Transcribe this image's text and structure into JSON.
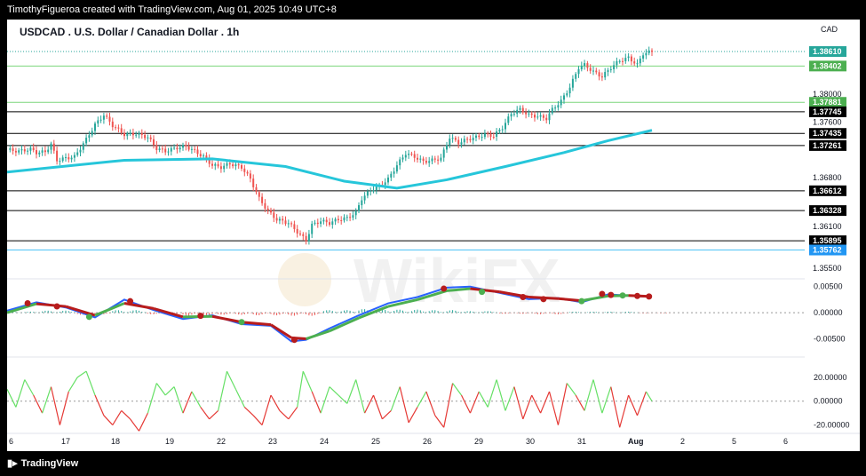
{
  "header": {
    "credit": "TimothyFigueroa created with TradingView.com, Aug 01, 2025 10:49 UTC+8"
  },
  "chart_title": "USDCAD . U.S. Dollar / Canadian Dollar . 1h",
  "currency": "CAD",
  "footer": {
    "brand": "TradingView",
    "logo_icon": "tradingview-logo-icon"
  },
  "watermark": "WikiFX",
  "colors": {
    "up": "#26a69a",
    "down": "#ef5350",
    "ma": "#26c6da",
    "macd_fast": "#2962ff",
    "macd_green": "#4caf50",
    "macd_red": "#b71c1c",
    "osc_green": "#66e066",
    "osc_red": "#e53935"
  },
  "chart_data": [
    {
      "type": "candlestick",
      "title": "USDCAD . U.S. Dollar / Canadian Dollar . 1h",
      "x_ticks": [
        "6",
        "17",
        "18",
        "19",
        "22",
        "23",
        "24",
        "25",
        "26",
        "29",
        "30",
        "31",
        "Aug",
        "2",
        "5",
        "6"
      ],
      "y_ticks": [
        "1.38000",
        "1.37600",
        "1.36800",
        "1.36100",
        "1.35500"
      ],
      "ylim": [
        1.3545,
        1.3898
      ],
      "close_path": [
        [
          0,
          1.372
        ],
        [
          4,
          1.3718
        ],
        [
          8,
          1.3721
        ],
        [
          10,
          1.3716
        ],
        [
          13,
          1.3717
        ],
        [
          15,
          1.3728
        ],
        [
          17,
          1.3705
        ],
        [
          20,
          1.3708
        ],
        [
          23,
          1.371
        ],
        [
          27,
          1.3735
        ],
        [
          30,
          1.3756
        ],
        [
          33,
          1.377
        ],
        [
          36,
          1.3755
        ],
        [
          40,
          1.3742
        ],
        [
          44,
          1.3743
        ],
        [
          48,
          1.3738
        ],
        [
          51,
          1.3722
        ],
        [
          54,
          1.3718
        ],
        [
          58,
          1.3723
        ],
        [
          61,
          1.3725
        ],
        [
          64,
          1.3718
        ],
        [
          67,
          1.371
        ],
        [
          70,
          1.3698
        ],
        [
          73,
          1.3695
        ],
        [
          76,
          1.37
        ],
        [
          80,
          1.3695
        ],
        [
          83,
          1.3678
        ],
        [
          86,
          1.365
        ],
        [
          89,
          1.3632
        ],
        [
          92,
          1.362
        ],
        [
          96,
          1.3615
        ],
        [
          100,
          1.3598
        ],
        [
          102,
          1.359
        ],
        [
          104,
          1.3612
        ],
        [
          107,
          1.3618
        ],
        [
          110,
          1.3615
        ],
        [
          113,
          1.362
        ],
        [
          116,
          1.3622
        ],
        [
          119,
          1.363
        ],
        [
          121,
          1.365
        ],
        [
          124,
          1.3662
        ],
        [
          127,
          1.3668
        ],
        [
          130,
          1.3678
        ],
        [
          133,
          1.3698
        ],
        [
          136,
          1.3715
        ],
        [
          139,
          1.371
        ],
        [
          142,
          1.3703
        ],
        [
          145,
          1.3705
        ],
        [
          148,
          1.3708
        ],
        [
          151,
          1.3738
        ],
        [
          154,
          1.373
        ],
        [
          157,
          1.3735
        ],
        [
          160,
          1.3738
        ],
        [
          163,
          1.3742
        ],
        [
          166,
          1.374
        ],
        [
          169,
          1.3752
        ],
        [
          172,
          1.3772
        ],
        [
          175,
          1.3778
        ],
        [
          178,
          1.377
        ],
        [
          181,
          1.3768
        ],
        [
          184,
          1.3765
        ],
        [
          186,
          1.3778
        ],
        [
          189,
          1.379
        ],
        [
          192,
          1.381
        ],
        [
          195,
          1.3838
        ],
        [
          197,
          1.3842
        ],
        [
          200,
          1.3832
        ],
        [
          203,
          1.3825
        ],
        [
          206,
          1.3838
        ],
        [
          209,
          1.3848
        ],
        [
          212,
          1.3852
        ],
        [
          215,
          1.3842
        ],
        [
          217,
          1.3858
        ],
        [
          220,
          1.3861
        ]
      ],
      "moving_average": [
        [
          0,
          1.3688
        ],
        [
          40,
          1.3705
        ],
        [
          70,
          1.3707
        ],
        [
          95,
          1.3696
        ],
        [
          115,
          1.3675
        ],
        [
          133,
          1.3665
        ],
        [
          150,
          1.3677
        ],
        [
          170,
          1.3696
        ],
        [
          190,
          1.3716
        ],
        [
          205,
          1.3733
        ],
        [
          220,
          1.3748
        ]
      ],
      "horizontal_levels": [
        {
          "value": 1.3861,
          "label": "1.38610",
          "kind": "current"
        },
        {
          "value": 1.38402,
          "label": "1.38402",
          "kind": "green"
        },
        {
          "value": 1.37881,
          "label": "1.37881",
          "kind": "green"
        },
        {
          "value": 1.37745,
          "label": "1.37745",
          "kind": "black"
        },
        {
          "value": 1.37435,
          "label": "1.37435",
          "kind": "black"
        },
        {
          "value": 1.37261,
          "label": "1.37261",
          "kind": "black"
        },
        {
          "value": 1.36612,
          "label": "1.36612",
          "kind": "black"
        },
        {
          "value": 1.36328,
          "label": "1.36328",
          "kind": "black"
        },
        {
          "value": 1.35895,
          "label": "1.35895",
          "kind": "black"
        },
        {
          "value": 1.35762,
          "label": "1.35762",
          "kind": "blue"
        }
      ]
    },
    {
      "type": "line",
      "y_ticks": [
        "0.00500",
        "0.00000",
        "-0.00500"
      ],
      "ylim": [
        -0.0078,
        0.0058
      ],
      "macd": [
        [
          0,
          0.0004
        ],
        [
          10,
          0.002
        ],
        [
          20,
          0.001
        ],
        [
          30,
          -0.0009
        ],
        [
          40,
          0.0025
        ],
        [
          50,
          0.0005
        ],
        [
          60,
          -0.0012
        ],
        [
          70,
          -0.0005
        ],
        [
          80,
          -0.0022
        ],
        [
          90,
          -0.0025
        ],
        [
          97,
          -0.0055
        ],
        [
          102,
          -0.0052
        ],
        [
          110,
          -0.003
        ],
        [
          120,
          -0.0005
        ],
        [
          130,
          0.0018
        ],
        [
          140,
          0.003
        ],
        [
          150,
          0.0048
        ],
        [
          158,
          0.005
        ],
        [
          168,
          0.0038
        ],
        [
          178,
          0.0026
        ],
        [
          188,
          0.0028
        ],
        [
          196,
          0.002
        ],
        [
          205,
          0.0035
        ],
        [
          212,
          0.0033
        ],
        [
          220,
          0.003
        ]
      ],
      "signal": [
        [
          0,
          0.0
        ],
        [
          10,
          0.0017
        ],
        [
          20,
          0.0012
        ],
        [
          30,
          -0.0005
        ],
        [
          40,
          0.0018
        ],
        [
          50,
          0.0008
        ],
        [
          60,
          -0.0008
        ],
        [
          70,
          -0.0007
        ],
        [
          80,
          -0.0018
        ],
        [
          90,
          -0.0023
        ],
        [
          97,
          -0.0048
        ],
        [
          102,
          -0.005
        ],
        [
          110,
          -0.0035
        ],
        [
          120,
          -0.001
        ],
        [
          130,
          0.0012
        ],
        [
          140,
          0.0025
        ],
        [
          150,
          0.0042
        ],
        [
          158,
          0.0046
        ],
        [
          168,
          0.004
        ],
        [
          178,
          0.003
        ],
        [
          188,
          0.0027
        ],
        [
          196,
          0.0023
        ],
        [
          205,
          0.0032
        ],
        [
          212,
          0.0033
        ],
        [
          220,
          0.0031
        ]
      ],
      "cross_points": [
        [
          7,
          0.0018
        ],
        [
          17,
          0.0012
        ],
        [
          28,
          -0.0008
        ],
        [
          42,
          0.0022
        ],
        [
          66,
          -0.0006
        ],
        [
          80,
          -0.0018
        ],
        [
          98,
          -0.0052
        ],
        [
          149,
          0.0046
        ],
        [
          162,
          0.004
        ],
        [
          176,
          0.003
        ],
        [
          183,
          0.0026
        ],
        [
          196,
          0.0022
        ],
        [
          203,
          0.0036
        ],
        [
          206,
          0.0034
        ],
        [
          210,
          0.0033
        ],
        [
          215,
          0.0032
        ],
        [
          219,
          0.0031
        ]
      ],
      "histogram": [
        [
          0,
          0.0002
        ],
        [
          12,
          0.0004
        ],
        [
          24,
          -0.0004
        ],
        [
          36,
          0.0005
        ],
        [
          48,
          -0.0003
        ],
        [
          60,
          -0.0006
        ],
        [
          72,
          -0.0004
        ],
        [
          84,
          -0.0005
        ],
        [
          96,
          -0.0006
        ],
        [
          108,
          0.0005
        ],
        [
          120,
          0.0007
        ],
        [
          132,
          0.0006
        ],
        [
          144,
          0.0005
        ],
        [
          156,
          0.0003
        ],
        [
          168,
          -0.0002
        ],
        [
          180,
          -0.0003
        ],
        [
          192,
          0.0002
        ],
        [
          204,
          0.0002
        ],
        [
          216,
          -0.0001
        ]
      ]
    },
    {
      "type": "line",
      "y_ticks": [
        "20.00000",
        "0.00000",
        "-20.00000"
      ],
      "ylim": [
        -27,
        34
      ],
      "values": [
        [
          0,
          10
        ],
        [
          3,
          -5
        ],
        [
          6,
          18
        ],
        [
          9,
          5
        ],
        [
          12,
          -10
        ],
        [
          15,
          12
        ],
        [
          18,
          -20
        ],
        [
          21,
          8
        ],
        [
          24,
          20
        ],
        [
          27,
          25
        ],
        [
          30,
          5
        ],
        [
          33,
          -12
        ],
        [
          36,
          -20
        ],
        [
          39,
          -8
        ],
        [
          42,
          -15
        ],
        [
          45,
          -25
        ],
        [
          48,
          -10
        ],
        [
          51,
          15
        ],
        [
          54,
          5
        ],
        [
          57,
          12
        ],
        [
          60,
          -10
        ],
        [
          63,
          8
        ],
        [
          66,
          -5
        ],
        [
          69,
          -15
        ],
        [
          72,
          -8
        ],
        [
          75,
          25
        ],
        [
          78,
          10
        ],
        [
          81,
          -5
        ],
        [
          84,
          -12
        ],
        [
          87,
          -20
        ],
        [
          90,
          5
        ],
        [
          93,
          -8
        ],
        [
          96,
          -15
        ],
        [
          99,
          -5
        ],
        [
          101,
          25
        ],
        [
          104,
          8
        ],
        [
          107,
          -10
        ],
        [
          110,
          12
        ],
        [
          113,
          5
        ],
        [
          116,
          -2
        ],
        [
          119,
          18
        ],
        [
          122,
          -10
        ],
        [
          125,
          5
        ],
        [
          128,
          -15
        ],
        [
          131,
          -8
        ],
        [
          134,
          12
        ],
        [
          137,
          -18
        ],
        [
          140,
          -5
        ],
        [
          143,
          8
        ],
        [
          146,
          -12
        ],
        [
          149,
          -22
        ],
        [
          152,
          15
        ],
        [
          155,
          5
        ],
        [
          158,
          -10
        ],
        [
          161,
          8
        ],
        [
          164,
          -5
        ],
        [
          167,
          18
        ],
        [
          170,
          -8
        ],
        [
          173,
          12
        ],
        [
          176,
          -15
        ],
        [
          179,
          5
        ],
        [
          182,
          -10
        ],
        [
          185,
          8
        ],
        [
          188,
          -20
        ],
        [
          191,
          15
        ],
        [
          194,
          5
        ],
        [
          197,
          -8
        ],
        [
          200,
          18
        ],
        [
          203,
          -10
        ],
        [
          206,
          12
        ],
        [
          209,
          -22
        ],
        [
          212,
          5
        ],
        [
          215,
          -12
        ],
        [
          218,
          8
        ],
        [
          220,
          0
        ]
      ],
      "reference_line": 0
    }
  ]
}
